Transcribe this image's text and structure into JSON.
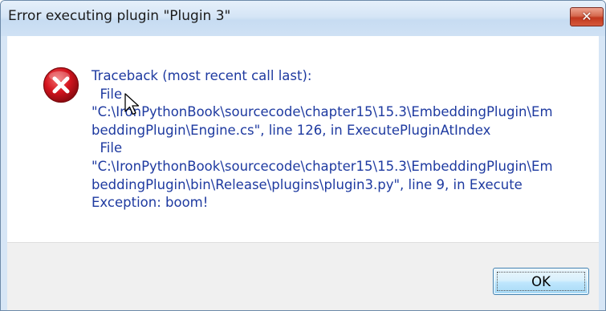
{
  "dialog": {
    "title": "Error executing plugin \"Plugin 3\"",
    "icon": "error-icon",
    "message": "Traceback (most recent call last):\n  File\n\"C:\\IronPythonBook\\sourcecode\\chapter15\\15.3\\EmbeddingPlugin\\Em\nbeddingPlugin\\Engine.cs\", line 126, in ExecutePluginAtIndex\n  File\n\"C:\\IronPythonBook\\sourcecode\\chapter15\\15.3\\EmbeddingPlugin\\Em\nbeddingPlugin\\bin\\Release\\plugins\\plugin3.py\", line 9, in Execute\nException: boom!",
    "ok_label": "OK",
    "close_glyph": "✕"
  },
  "colors": {
    "message_text": "#1e3aa0",
    "error_red": "#c8102e",
    "close_red": "#c2381e"
  }
}
